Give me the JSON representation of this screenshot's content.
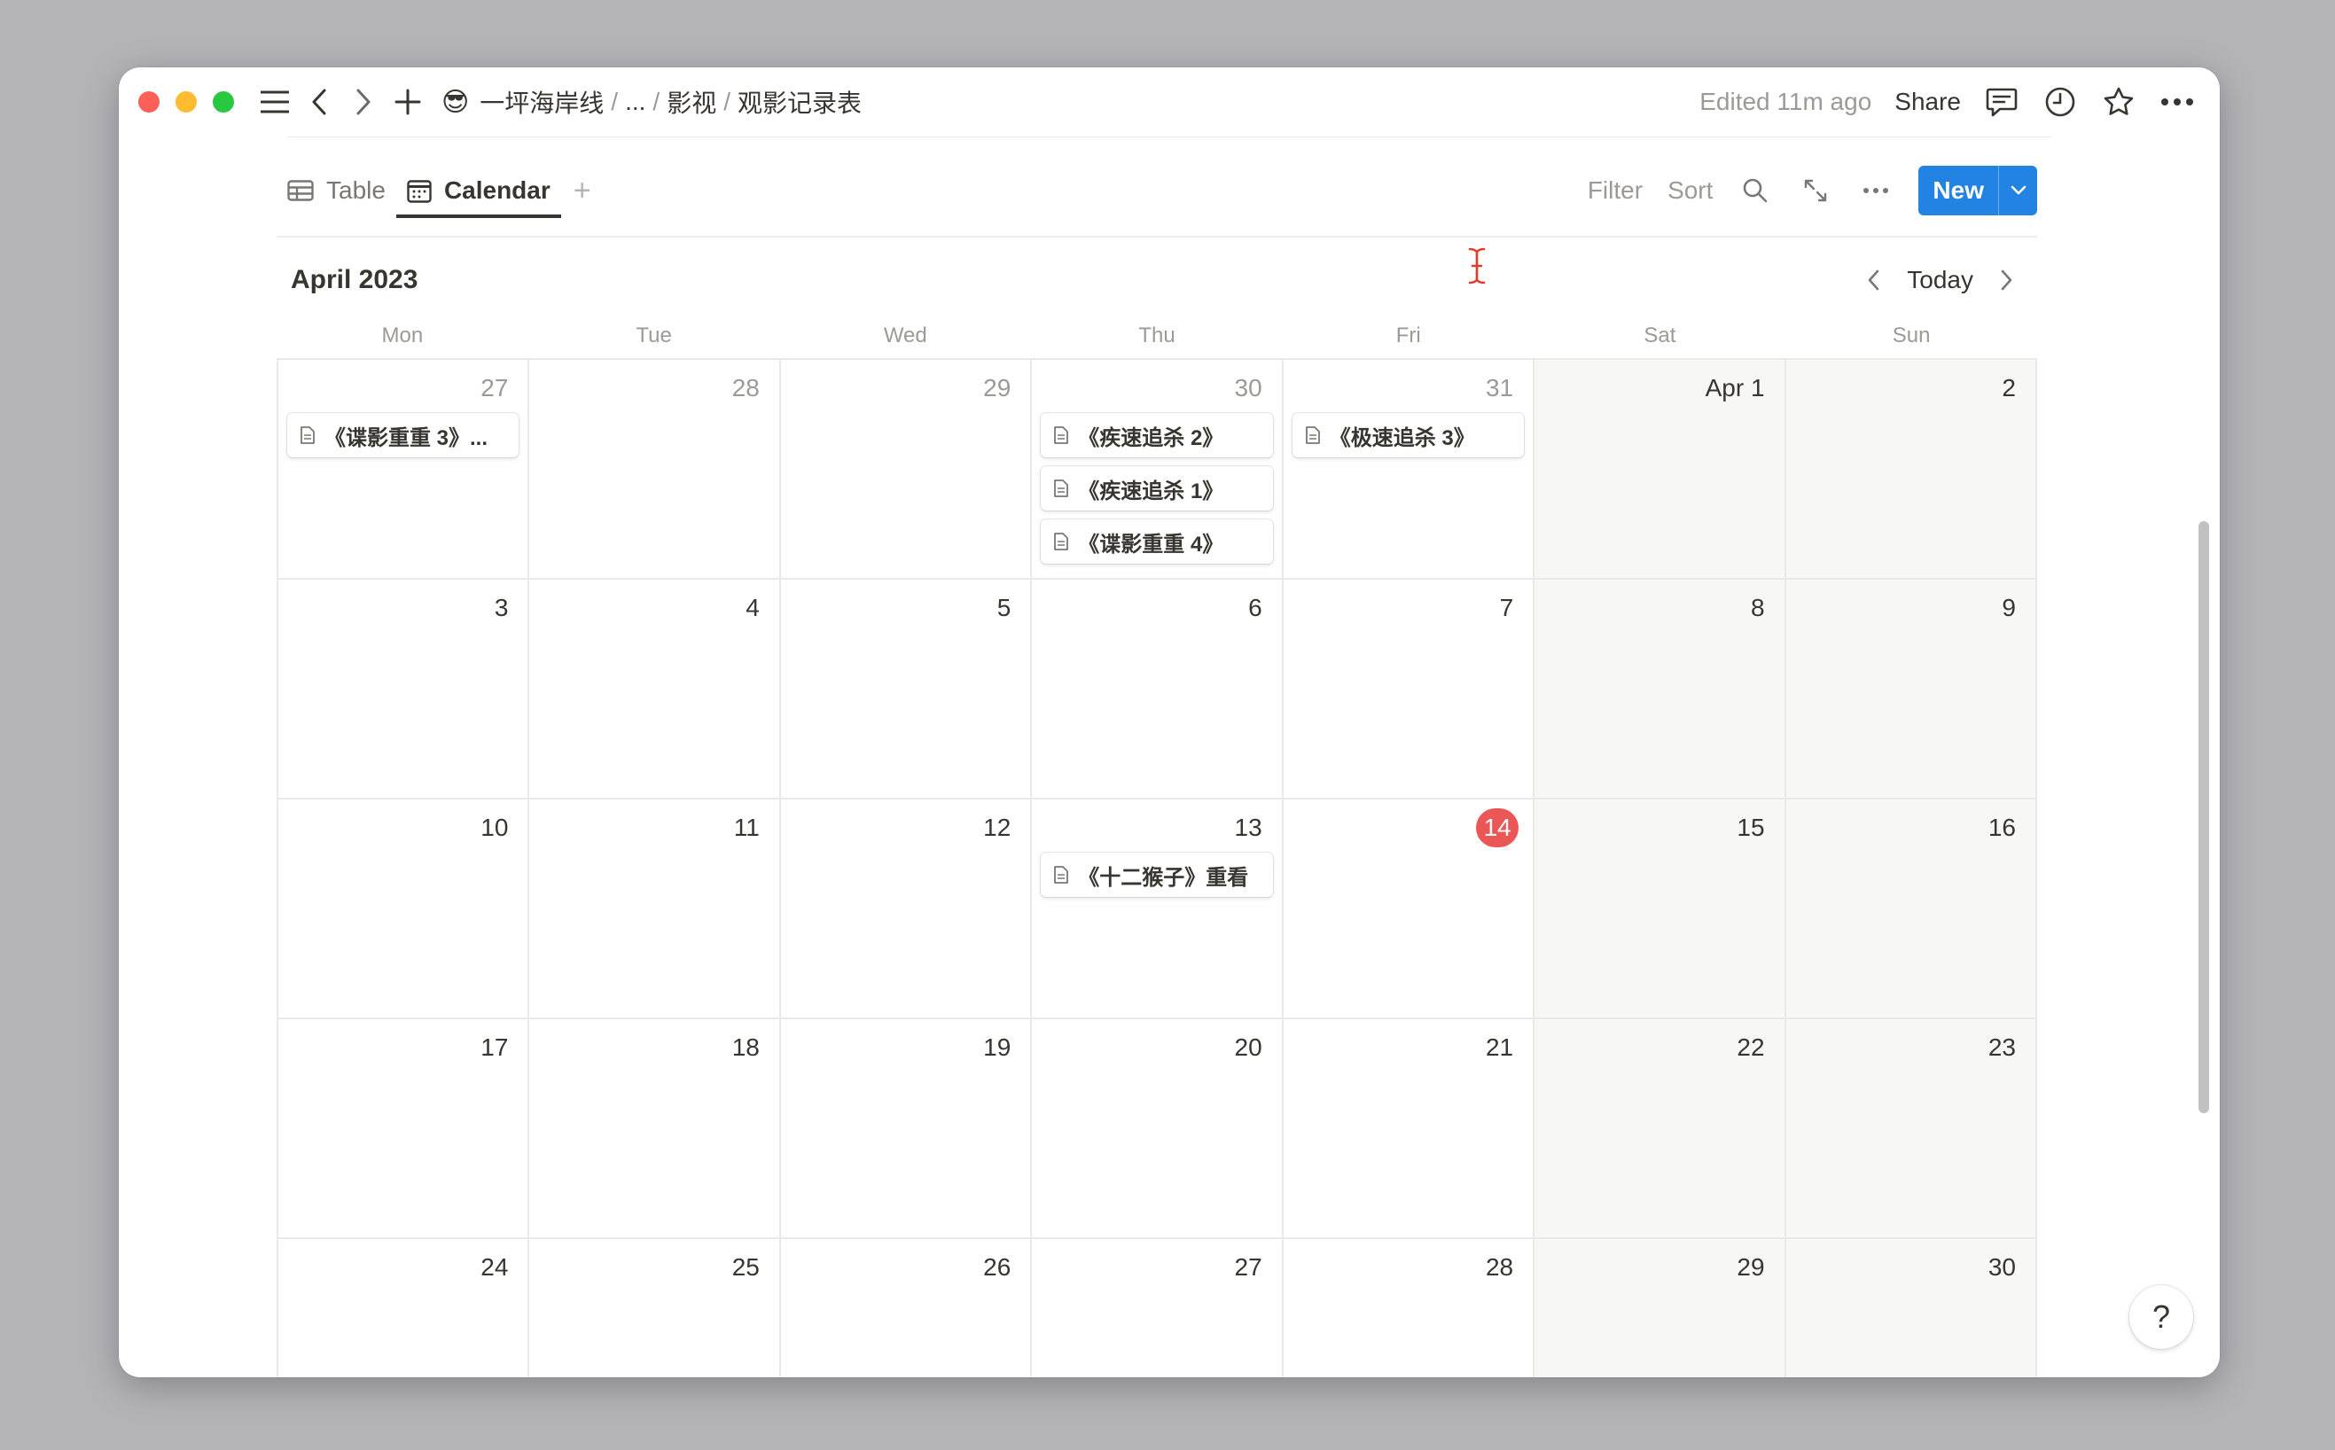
{
  "titlebar": {
    "workspace_emoji": "😎",
    "breadcrumbs": [
      {
        "label": "一坪海岸线"
      },
      {
        "label": "..."
      },
      {
        "label": "影视"
      },
      {
        "label": "观影记录表"
      }
    ],
    "separator": "/",
    "edited": "Edited 11m ago",
    "share": "Share"
  },
  "views": {
    "tabs": [
      {
        "label": "Table",
        "active": false
      },
      {
        "label": "Calendar",
        "active": true
      }
    ],
    "add_view": "+",
    "filter": "Filter",
    "sort": "Sort",
    "new_label": "New"
  },
  "calendar": {
    "month_title": "April 2023",
    "today_label": "Today",
    "weekdays": [
      "Mon",
      "Tue",
      "Wed",
      "Thu",
      "Fri",
      "Sat",
      "Sun"
    ],
    "today_color": "#eb5757",
    "weeks": [
      [
        {
          "day": "27",
          "dim": true,
          "events": [
            "《谍影重重 3》..."
          ]
        },
        {
          "day": "28",
          "dim": true,
          "events": []
        },
        {
          "day": "29",
          "dim": true,
          "events": []
        },
        {
          "day": "30",
          "dim": true,
          "events": [
            "《疾速追杀 2》",
            "《疾速追杀 1》",
            "《谍影重重 4》"
          ]
        },
        {
          "day": "31",
          "dim": true,
          "events": [
            "《极速追杀 3》"
          ]
        },
        {
          "day": "Apr 1",
          "dim": false,
          "events": []
        },
        {
          "day": "2",
          "dim": false,
          "events": []
        }
      ],
      [
        {
          "day": "3",
          "events": []
        },
        {
          "day": "4",
          "events": []
        },
        {
          "day": "5",
          "events": []
        },
        {
          "day": "6",
          "events": []
        },
        {
          "day": "7",
          "events": []
        },
        {
          "day": "8",
          "events": []
        },
        {
          "day": "9",
          "events": []
        }
      ],
      [
        {
          "day": "10",
          "events": []
        },
        {
          "day": "11",
          "events": []
        },
        {
          "day": "12",
          "events": []
        },
        {
          "day": "13",
          "events": [
            "《十二猴子》重看"
          ]
        },
        {
          "day": "14",
          "today": true,
          "events": []
        },
        {
          "day": "15",
          "events": []
        },
        {
          "day": "16",
          "events": []
        }
      ],
      [
        {
          "day": "17",
          "events": []
        },
        {
          "day": "18",
          "events": []
        },
        {
          "day": "19",
          "events": []
        },
        {
          "day": "20",
          "events": []
        },
        {
          "day": "21",
          "events": []
        },
        {
          "day": "22",
          "events": []
        },
        {
          "day": "23",
          "events": []
        }
      ],
      [
        {
          "day": "24",
          "events": []
        },
        {
          "day": "25",
          "events": []
        },
        {
          "day": "26",
          "events": []
        },
        {
          "day": "27",
          "events": []
        },
        {
          "day": "28",
          "events": []
        },
        {
          "day": "29",
          "events": []
        },
        {
          "day": "30",
          "events": []
        }
      ]
    ]
  },
  "help": "?",
  "colors": {
    "accent": "#2383e2",
    "today": "#eb5757",
    "close": "#fe5f57",
    "minimize": "#febc2e",
    "maximize": "#28c840"
  }
}
